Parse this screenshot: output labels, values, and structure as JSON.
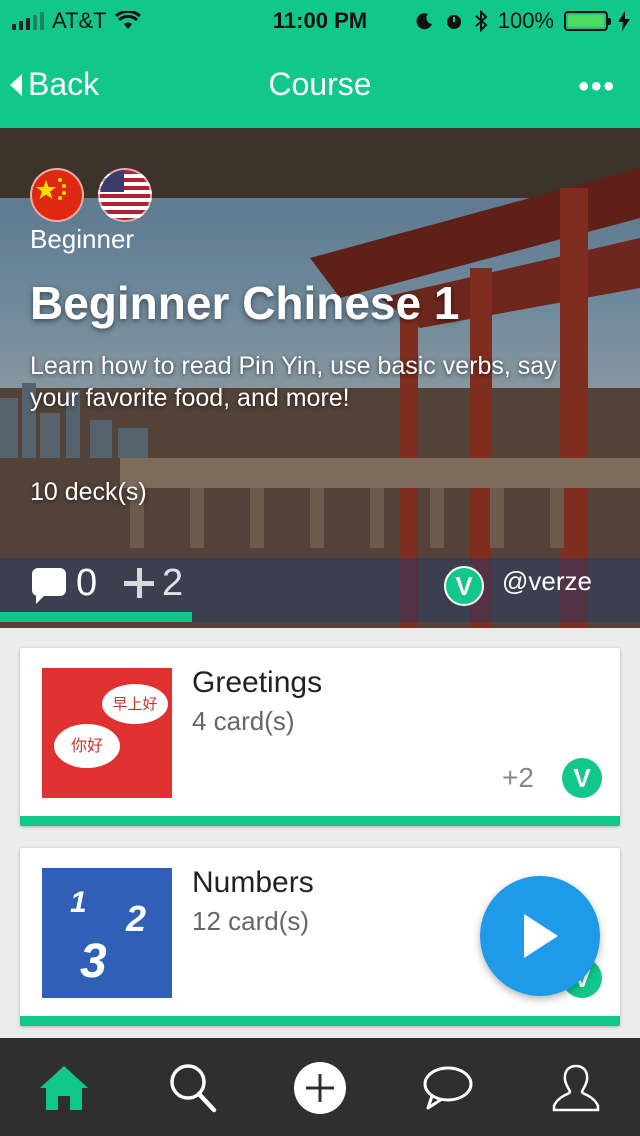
{
  "status_bar": {
    "carrier": "AT&T",
    "time": "11:00 PM",
    "battery": "100%"
  },
  "nav": {
    "back_label": "Back",
    "title": "Course",
    "more_label": "•••"
  },
  "course": {
    "level": "Beginner",
    "title": "Beginner Chinese 1",
    "description": "Learn how to read Pin Yin, use basic verbs, say your favorite food, and more!",
    "decks": "10 deck(s)",
    "comments": "0",
    "adds": "2",
    "author": "@verze",
    "badge_letter": "V",
    "progress_fraction": 0.3
  },
  "decks": [
    {
      "title": "Greetings",
      "count": "4 card(s)",
      "adds": "2",
      "badge_letter": "V",
      "bubble_a": "早上好",
      "bubble_b": "你好"
    },
    {
      "title": "Numbers",
      "count": "12 card(s)",
      "badge_letter": "V",
      "digits": [
        "1",
        "2",
        "3"
      ]
    }
  ],
  "tabs": [
    "home-icon",
    "search-icon",
    "add-icon",
    "chat-icon",
    "profile-icon"
  ],
  "colors": {
    "accent": "#12c78a",
    "fab": "#1e9be8",
    "tabbar": "#2f2f2f"
  }
}
